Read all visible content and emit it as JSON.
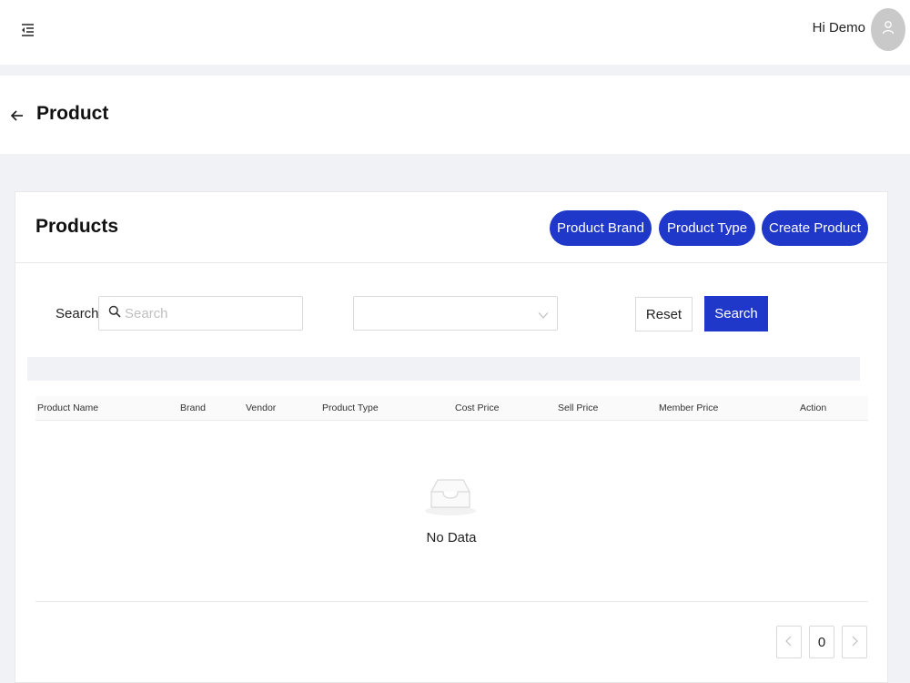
{
  "header": {
    "greeting": "Hi Demo",
    "menu_icon": "menu-fold-icon",
    "avatar_icon": "user-icon"
  },
  "page": {
    "title": "Product",
    "back_icon": "arrow-left-icon"
  },
  "card": {
    "title": "Products",
    "buttons": {
      "product_brand": "Product Brand",
      "product_type": "Product Type",
      "create_product": "Create Product"
    }
  },
  "filters": {
    "search_label": "Search:",
    "search_placeholder": "Search",
    "search_value": "",
    "select_value": "",
    "reset_label": "Reset",
    "search_button_label": "Search"
  },
  "table": {
    "columns": [
      "Product Name",
      "Brand",
      "Vendor",
      "Product Type",
      "Cost Price",
      "Sell Price",
      "Member Price",
      "Action"
    ],
    "rows": [],
    "empty_text": "No Data"
  },
  "pagination": {
    "current": "0",
    "prev_icon": "chevron-left-icon",
    "next_icon": "chevron-right-icon"
  },
  "colors": {
    "primary": "#1f38c9",
    "page_bg": "#f0f2f5",
    "avatar_bg": "#c9c9c9"
  }
}
